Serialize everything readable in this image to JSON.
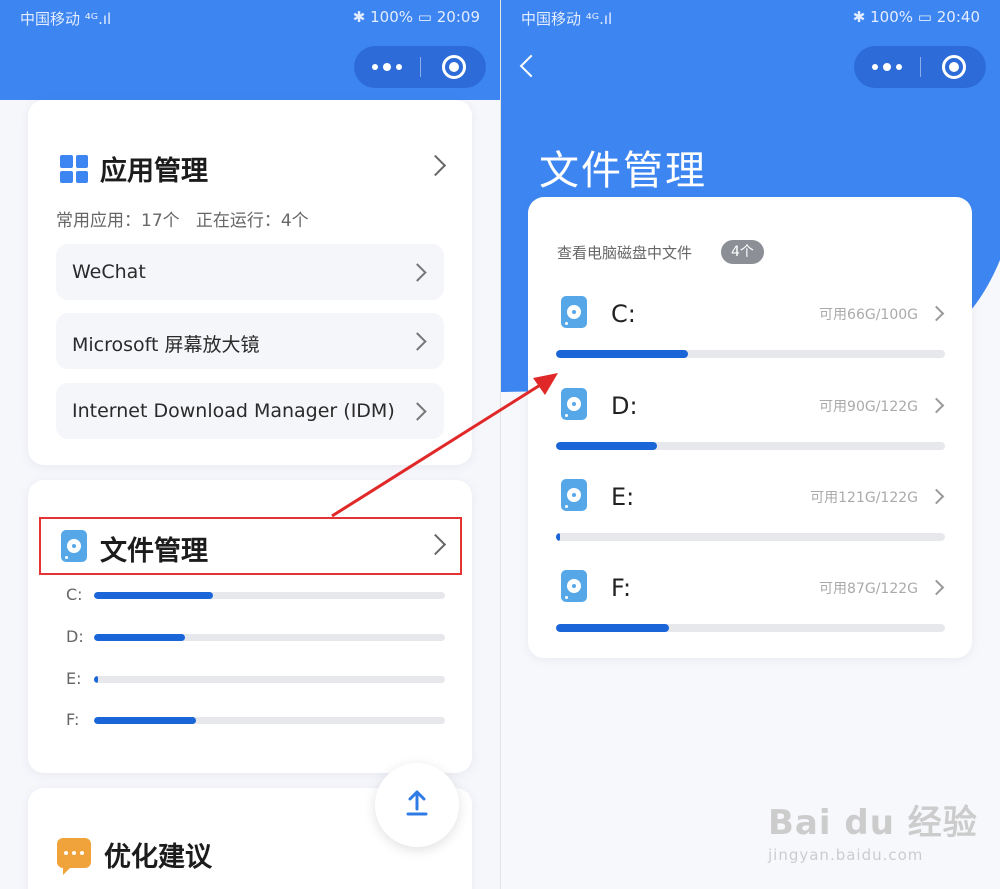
{
  "status_left": {
    "carrier": "中国移动 ⁴ᴳ.ıl",
    "battery": "100%",
    "time": "20:09"
  },
  "status_right": {
    "carrier": "中国移动 ⁴ᴳ.ıl",
    "battery": "100%",
    "time": "20:40"
  },
  "app_card": {
    "title": "应用管理",
    "summary": "常用应用：17个   正在运行：4个",
    "items": [
      {
        "label": "WeChat"
      },
      {
        "label": "Microsoft 屏幕放大镜"
      },
      {
        "label": "Internet Download Manager (IDM)"
      }
    ]
  },
  "file_card": {
    "title": "文件管理",
    "drives": [
      {
        "label": "C:",
        "usage": 0.34
      },
      {
        "label": "D:",
        "usage": 0.26
      },
      {
        "label": "E:",
        "usage": 0.01
      },
      {
        "label": "F:",
        "usage": 0.29
      }
    ]
  },
  "optimize_card": {
    "title": "优化建议"
  },
  "file_page": {
    "title": "文件管理",
    "subtitle": "查看电脑磁盘中文件",
    "count": "4个",
    "drives": [
      {
        "name": "C:",
        "avail": "可用66G/100G",
        "usage": 0.34
      },
      {
        "name": "D:",
        "avail": "可用90G/122G",
        "usage": 0.26
      },
      {
        "name": "E:",
        "avail": "可用121G/122G",
        "usage": 0.01
      },
      {
        "name": "F:",
        "avail": "可用87G/122G",
        "usage": 0.29
      }
    ]
  },
  "watermark": {
    "brand": "Bai du 经验",
    "url": "jingyan.baidu.com"
  },
  "colors": {
    "primary": "#3d86f1",
    "bar": "#1a66d9",
    "highlight": "#e53333"
  }
}
